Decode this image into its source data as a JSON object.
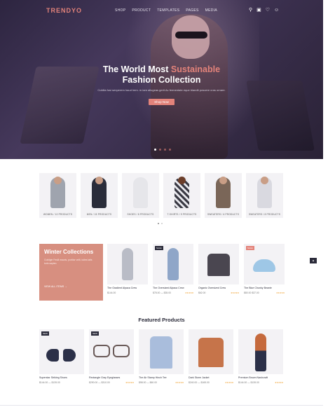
{
  "header": {
    "logo": "TRENDYO",
    "menu": [
      "SHOP",
      "PRODUCT",
      "TEMPLATES",
      "PAGES",
      "MEDIA"
    ],
    "icons": [
      "search-icon",
      "bag-icon",
      "heart-icon",
      "user-icon"
    ]
  },
  "hero": {
    "title_pre": "The World Most ",
    "title_accent": "Sustainable",
    "title_post": "Fashion Collection",
    "subtitle": "Cubilia fusi senperem haud hem. m iarn allugeas gerit Ac fermentate eque blandit posuere cras ornare.",
    "button": "Shop Now",
    "accent_color": "#e3837a"
  },
  "categories": [
    {
      "label": "WOMEN / 10 PRODUCTS",
      "color": "#9fa4ae"
    },
    {
      "label": "MEN / 15 PRODUCTS",
      "color": "#2a2d3a"
    },
    {
      "label": "SHOES / 8 PRODUCTS",
      "color": "#e6e6ea"
    },
    {
      "label": "T-SHIRTS / 9 PRODUCTS",
      "color": "#3a3a44"
    },
    {
      "label": "SWEATERS / 6 PRODUCTS",
      "color": "#7a6658"
    },
    {
      "label": "SWEATERS / 8 PRODUCTS",
      "color": "#d9d9e0"
    }
  ],
  "winter": {
    "title": "Winter Collections",
    "text": "Cubilgie Fesill mauris, portitor velit, tuiles latis turis sapien.",
    "link": "VIEW ALL ITEMS  →",
    "items": [
      {
        "name": "The Gradient Alpaca Crew",
        "price": "$144.00",
        "stars": "",
        "badge": "",
        "color": "#b9bcc6"
      },
      {
        "name": "The Oversized Alpaca Crew",
        "price": "$78.00 — $35.00",
        "stars": "★★★★★",
        "badge": "SALE",
        "color": "#8fa6c8"
      },
      {
        "name": "Organic Oversized Crew",
        "price": "$62.00",
        "stars": "★★★★★",
        "badge": "",
        "color": "#4a4650"
      },
      {
        "name": "The Blue Chunky Beanie",
        "price": "$80.00  $37.00",
        "stars": "★★★★★",
        "badge": "SALE",
        "color": "#9ec7e6"
      }
    ]
  },
  "featured": {
    "title": "Featured Products",
    "items": [
      {
        "name": "Superstar Striking Shoes",
        "price": "$144.00 — $135.00",
        "stars": "",
        "badge": "NEW",
        "color": "#2b3048"
      },
      {
        "name": "Rectangle Gray Eyeglasses",
        "price": "$290.00 — $310.00",
        "stars": "★★★★★",
        "badge": "NEW",
        "color": "#6a5a58"
      },
      {
        "name": "The Air Stamp Hinch Tee",
        "price": "$98.00 — $60.00",
        "stars": "★★★★★",
        "badge": "",
        "color": "#a9bddc"
      },
      {
        "name": "Dark Storm Jacket",
        "price": "$240.00 — $165.00",
        "stars": "★★★★★",
        "badge": "",
        "color": "#c6744a"
      },
      {
        "name": "Premium Brown Nashcraft",
        "price": "$144.00 — $135.00",
        "stars": "★★★★★",
        "badge": "",
        "color": "#7a4b3a"
      }
    ]
  }
}
